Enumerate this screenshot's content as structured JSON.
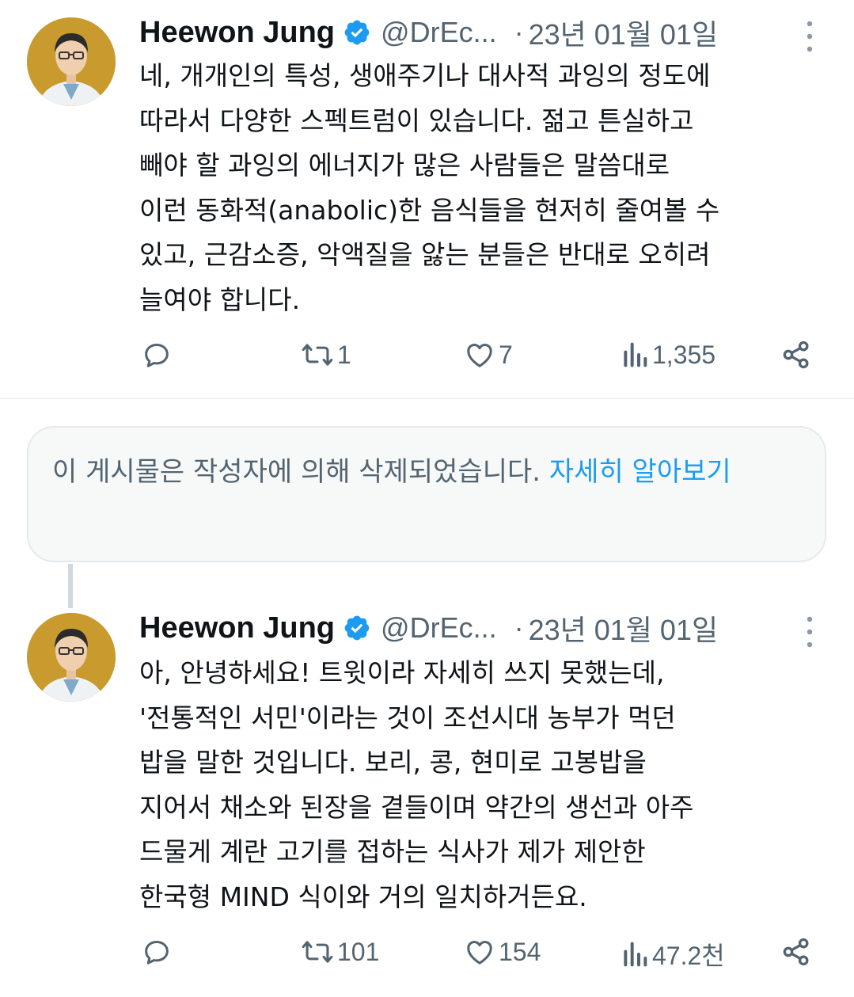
{
  "tweets": [
    {
      "author": {
        "name": "Heewon Jung",
        "handle": "@DrEc...",
        "verified": true
      },
      "date": "23년 01월 01일",
      "text": "네, 개개인의 특성, 생애주기나 대사적 과잉의 정도에\n따라서 다양한 스펙트럼이 있습니다. 젊고 튼실하고\n빼야 할 과잉의 에너지가 많은 사람들은 말씀대로\n이런 동화적(anabolic)한 음식들을 현저히 줄여볼 수\n있고, 근감소증, 악액질을 앓는 분들은 반대로 오히려\n늘여야 합니다.",
      "stats": {
        "replies": "",
        "retweets": "1",
        "likes": "7",
        "views": "1,355"
      }
    },
    {
      "author": {
        "name": "Heewon Jung",
        "handle": "@DrEc...",
        "verified": true
      },
      "date": "23년 01월 01일",
      "text": "아, 안녕하세요! 트윗이라 자세히 쓰지 못했는데,\n'전통적인 서민'이라는 것이 조선시대 농부가 먹던\n밥을 말한 것입니다. 보리, 콩, 현미로 고봉밥을\n지어서 채소와 된장을 곁들이며 약간의 생선과 아주\n드물게 계란 고기를 접하는 식사가 제가 제안한\n한국형 MIND 식이와 거의 일치하거든요.",
      "stats": {
        "replies": "",
        "retweets": "101",
        "likes": "154",
        "views": "47.2천"
      }
    }
  ],
  "deleted_notice": {
    "text": "이 게시물은 작성자에 의해 삭제되었습니다.",
    "link": "자세히 알아보기"
  },
  "colors": {
    "accent": "#1d9bf0",
    "secondary": "#536471",
    "text": "#0f1419"
  }
}
